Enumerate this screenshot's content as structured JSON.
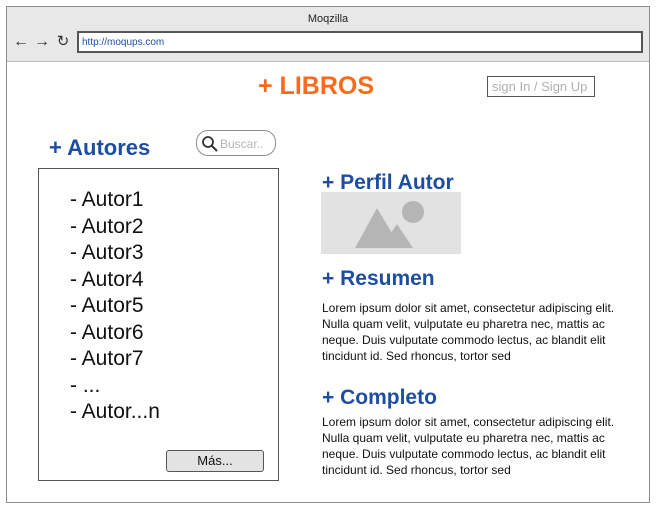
{
  "browser": {
    "title": "Moqzilla",
    "url": "http://moqups.com"
  },
  "header": {
    "brand": "+ LIBROS",
    "signin_label": "sign In / Sign Up"
  },
  "authors": {
    "heading": "+ Autores",
    "search_placeholder": "Buscar..",
    "items": [
      "- Autor1",
      "- Autor2",
      "- Autor3",
      "- Autor4",
      "- Autor5",
      "- Autor6",
      "- Autor7",
      "- ...",
      "- Autor...n"
    ],
    "more_label": "Más..."
  },
  "profile": {
    "heading": "+ Perfil Autor",
    "image_icon": "image-placeholder-icon",
    "summary_heading": "+ Resumen",
    "summary_text": "Lorem ipsum dolor sit amet, consectetur adipiscing elit. Nulla quam velit, vulputate eu pharetra nec, mattis ac neque. Duis vulputate commodo lectus, ac blandit elit tincidunt id. Sed rhoncus, tortor sed",
    "complete_heading": "+ Completo",
    "complete_text": "Lorem ipsum dolor sit amet, consectetur adipiscing elit. Nulla quam velit, vulputate eu pharetra nec, mattis ac neque. Duis vulputate commodo lectus, ac blandit elit tincidunt id. Sed rhoncus, tortor sed"
  },
  "colors": {
    "brand": "#ff6a1a",
    "heading": "#1d4ea3",
    "url_text": "#1d4ea3"
  }
}
